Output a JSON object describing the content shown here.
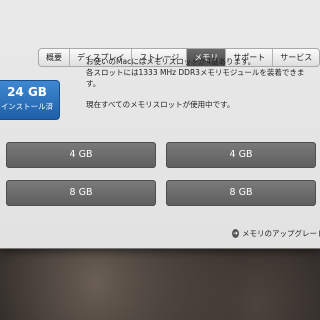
{
  "tabs": [
    {
      "label": "概要",
      "active": false
    },
    {
      "label": "ディスプレイ",
      "active": false
    },
    {
      "label": "ストレージ",
      "active": false
    },
    {
      "label": "メモリ",
      "active": true
    },
    {
      "label": "サポート",
      "active": false
    },
    {
      "label": "サービス",
      "active": false
    }
  ],
  "memory_summary": {
    "amount": "24 GB",
    "status": "インストール済"
  },
  "info": {
    "line1": "お使いのMacにはメモリスロットが4基あります。",
    "line2": "各スロットには1333 MHz DDR3メモリモジュールを装着できます。",
    "line3": "現在すべてのメモリスロットが使用中です。"
  },
  "slots": [
    "4 GB",
    "4 GB",
    "8 GB",
    "8 GB"
  ],
  "upgrade_link": "メモリのアップグレードの"
}
